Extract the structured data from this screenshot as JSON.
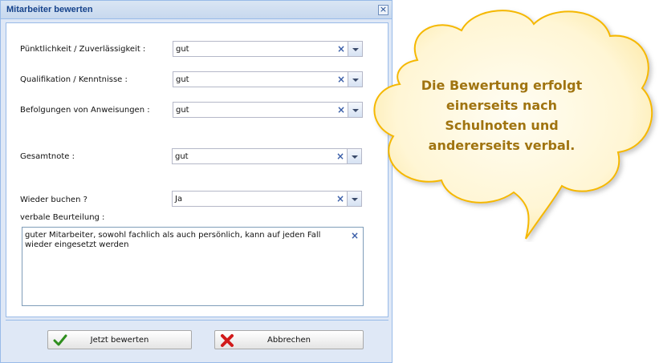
{
  "window": {
    "title": "Mitarbeiter bewerten"
  },
  "fields": {
    "puenktlichkeit": {
      "label": "Pünktlichkeit / Zuverlässigkeit :",
      "value": "gut"
    },
    "qualifikation": {
      "label": "Qualifikation / Kenntnisse :",
      "value": "gut"
    },
    "befolgungen": {
      "label": "Befolgungen von Anweisungen :",
      "value": "gut"
    },
    "gesamtnote": {
      "label": "Gesamtnote :",
      "value": "gut"
    },
    "wieder_buchen": {
      "label": "Wieder buchen ?",
      "value": "Ja"
    },
    "beurteilung": {
      "label": "verbale Beurteilung :",
      "value": "guter Mitarbeiter, sowohl fachlich als auch persönlich, kann auf jeden Fall wieder eingesetzt werden"
    }
  },
  "buttons": {
    "submit": "Jetzt bewerten",
    "cancel": "Abbrechen"
  },
  "callout": {
    "line1": "Die Bewertung erfolgt",
    "line2": "einerseits nach",
    "line3": "Schulnoten und",
    "line4": "andererseits verbal."
  },
  "icons": {
    "close": "close-icon",
    "clear": "clear-x-icon",
    "dropdown": "chevron-down-icon",
    "submit": "checkmark-icon",
    "cancel": "red-x-icon"
  },
  "colors": {
    "title_text": "#15428b",
    "callout_text": "#a07410",
    "callout_fill": "#fff6d5",
    "callout_border": "#f5b800"
  }
}
